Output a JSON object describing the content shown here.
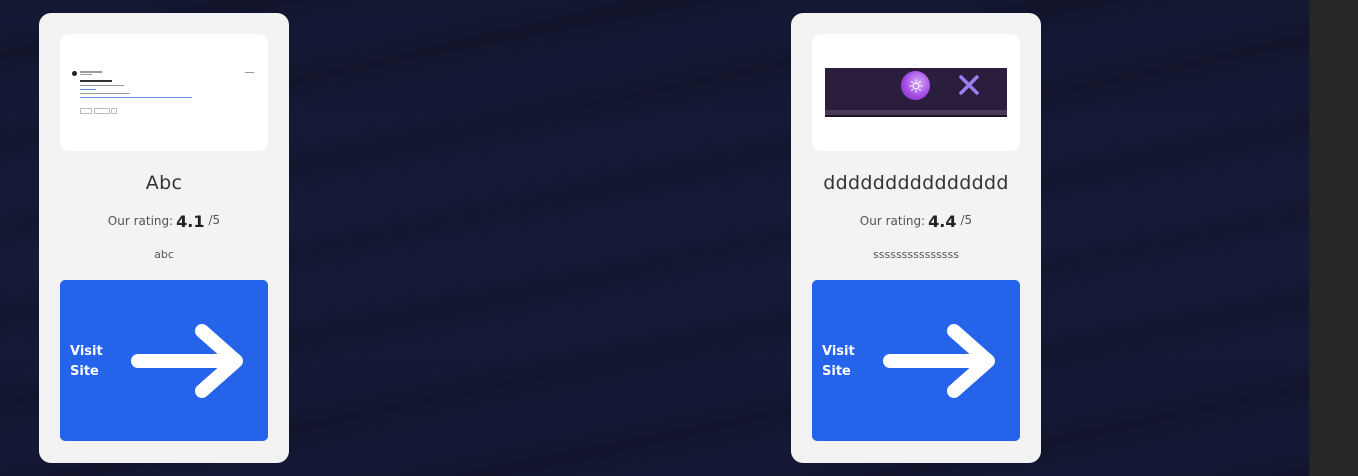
{
  "cards": [
    {
      "title": "Abc",
      "rating_label": "Our rating:",
      "rating_value": "4.1",
      "rating_max": "/5",
      "description": "abc",
      "visit_label_line1": "Visit",
      "visit_label_line2": "Site"
    },
    {
      "title": "ddddddddddddddd",
      "rating_label": "Our rating:",
      "rating_value": "4.4",
      "rating_max": "/5",
      "description": "sssssssssssssss",
      "visit_label_line1": "Visit",
      "visit_label_line2": "Site"
    }
  ],
  "colors": {
    "background": "#151a33",
    "card": "#f3f3f3",
    "visit_button": "#2563eb",
    "scrollbar_strip": "#262626"
  },
  "icons": {
    "visit_arrow": "arrow-right-icon",
    "thumbnail_orb": "sun-icon",
    "thumbnail_close": "close-icon"
  }
}
